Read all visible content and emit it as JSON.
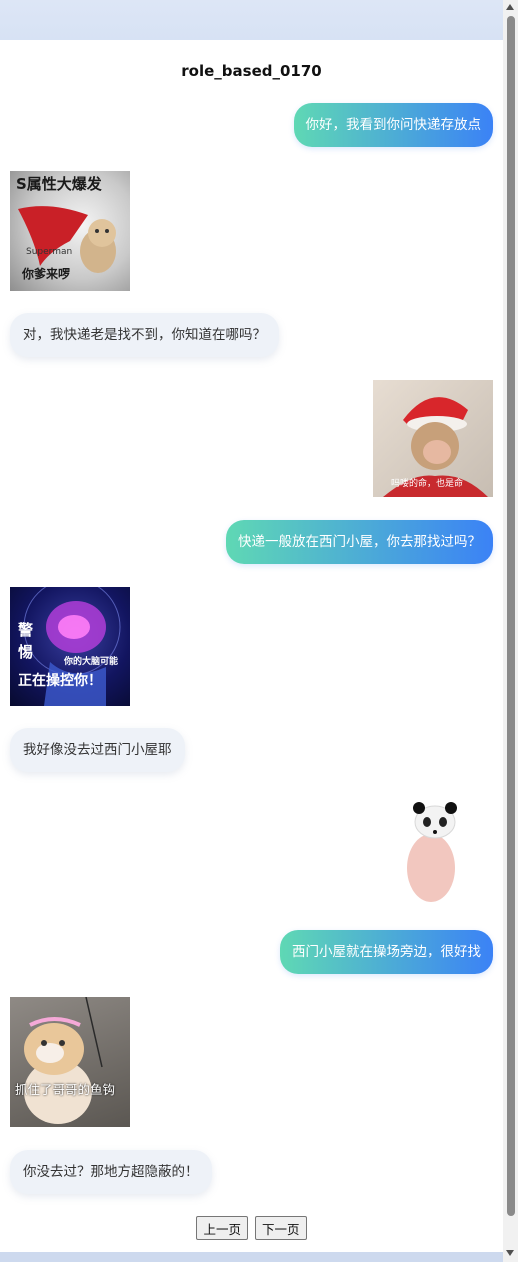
{
  "page": {
    "title": "role_based_0170"
  },
  "messages": [
    {
      "role": "user",
      "text": "你好，我看到你问快递存放点"
    },
    {
      "role": "bot-sticker",
      "caption_top": "S属性大爆发",
      "caption_small": "Superman",
      "caption_bottom": "你爹来啰"
    },
    {
      "role": "bot",
      "text": "对，我快递老是找不到，你知道在哪吗？"
    },
    {
      "role": "user-sticker",
      "caption": "吗喽的命，也是命"
    },
    {
      "role": "user",
      "text": "快递一般放在西门小屋，你去那找过吗？"
    },
    {
      "role": "bot-sticker",
      "caption_side": "警惕",
      "caption_small": "你的大脑可能",
      "caption_bottom": "正在操控你！"
    },
    {
      "role": "bot",
      "text": "我好像没去过西门小屋耶"
    },
    {
      "role": "user-sticker",
      "caption": ""
    },
    {
      "role": "user",
      "text": "西门小屋就在操场旁边，很好找"
    },
    {
      "role": "bot-sticker",
      "caption": "抓住了哥哥的鱼钩"
    },
    {
      "role": "bot",
      "text": "你没去过？那地方超隐蔽的！"
    }
  ],
  "pager": {
    "prev_label": "上一页",
    "next_label": "下一页"
  },
  "colors": {
    "user_gradient_start": "#5fd8b4",
    "user_gradient_end": "#3b82f6",
    "bot_bubble": "#eef2f8"
  }
}
